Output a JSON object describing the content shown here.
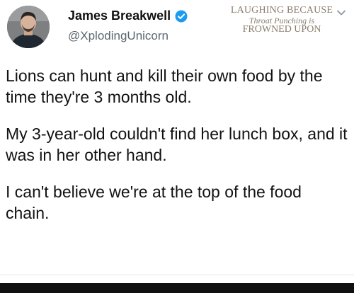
{
  "author": {
    "display_name": "James Breakwell",
    "handle": "@XplodingUnicorn",
    "verified": true
  },
  "watermark": {
    "line1": "LAUGHING BECAUSE",
    "line2": "Throat Punching is",
    "line3": "FROWNED UPON"
  },
  "tweet": {
    "paragraphs": [
      "Lions can hunt and kill their own food by the time they're 3 months old.",
      "My 3-year-old couldn't find her lunch box, and it was in her other hand.",
      "I can't believe we're at the top of the food chain."
    ]
  },
  "icons": {
    "verified": "verified-badge-icon",
    "menu": "chevron-down-icon"
  },
  "colors": {
    "verified_blue": "#1d9bf0",
    "watermark": "#8a7d6d",
    "handle_gray": "#5b6770"
  }
}
